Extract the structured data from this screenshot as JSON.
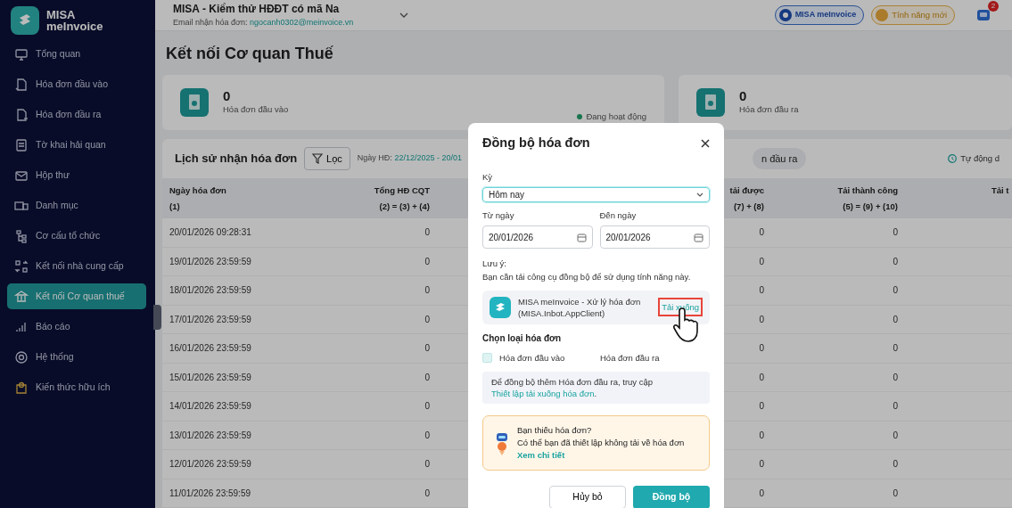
{
  "sidebar": {
    "logo": {
      "line1": "MISA",
      "line2": "meInvoice"
    },
    "items": [
      {
        "label": "Tổng quan",
        "selected": false
      },
      {
        "label": "Hóa đơn đầu vào",
        "selected": false
      },
      {
        "label": "Hóa đơn đầu ra",
        "selected": false
      },
      {
        "label": "Tờ khai hải quan",
        "selected": false
      },
      {
        "label": "Hộp thư",
        "selected": false
      },
      {
        "label": "Danh mục",
        "selected": false
      },
      {
        "label": "Cơ cấu tổ chức",
        "selected": false
      },
      {
        "label": "Kết nối nhà cung cấp",
        "selected": false
      },
      {
        "label": "Kết nối Cơ quan thuế",
        "selected": true
      },
      {
        "label": "Báo cáo",
        "selected": false
      },
      {
        "label": "Hệ thống",
        "selected": false
      },
      {
        "label": "Kiến thức hữu ích",
        "selected": false
      }
    ]
  },
  "header": {
    "company": "MISA - Kiểm thử HĐĐT có mã Na",
    "email_label": "Email nhận hóa đơn:",
    "email": "ngocanh0302@meinvoice.vn",
    "brand_badge": "MISA meInvoice",
    "new_features": "Tính năng mới",
    "notification_count": "2"
  },
  "page_title": "Kết nối Cơ quan Thuế",
  "stats": [
    {
      "value": "0",
      "label": "Hóa đơn đầu vào",
      "status": {
        "text": "Đang hoạt động",
        "active": true
      }
    },
    {
      "value": "0",
      "label": "Hóa đơn đầu ra"
    }
  ],
  "history": {
    "title": "Lịch sử nhận hóa đơn",
    "filter_button": "Lọc",
    "date_label": "Ngày HĐ:",
    "date_range": "22/12/2025 - 20/01",
    "tab": "n đầu ra",
    "auto_label": "Tự động d",
    "columns": [
      {
        "title": "Ngày hóa đơn",
        "formula": "(1)"
      },
      {
        "title": "Tổng HĐ CQT",
        "formula": "(2) = (3) + (4)"
      },
      {
        "title": "tải được",
        "formula": "(7) + (8)"
      },
      {
        "title": "Tải thành công",
        "formula": "(5) = (9) + (10)"
      },
      {
        "title": "Tải t"
      }
    ],
    "rows": [
      [
        "20/01/2026 09:28:31",
        "0",
        "0",
        "0"
      ],
      [
        "19/01/2026 23:59:59",
        "0",
        "0",
        "0"
      ],
      [
        "18/01/2026 23:59:59",
        "0",
        "0",
        "0"
      ],
      [
        "17/01/2026 23:59:59",
        "0",
        "0",
        "0"
      ],
      [
        "16/01/2026 23:59:59",
        "0",
        "0",
        "0"
      ],
      [
        "15/01/2026 23:59:59",
        "0",
        "0",
        "0"
      ],
      [
        "14/01/2026 23:59:59",
        "0",
        "0",
        "0"
      ],
      [
        "13/01/2026 23:59:59",
        "0",
        "0",
        "0"
      ],
      [
        "12/01/2026 23:59:59",
        "0",
        "0",
        "0"
      ],
      [
        "11/01/2026 23:59:59",
        "0",
        "0",
        "0"
      ]
    ]
  },
  "dialog": {
    "title": "Đồng bộ hóa đơn",
    "period": {
      "label": "Kỳ",
      "value": "Hôm nay",
      "focused": true
    },
    "from": {
      "label": "Từ ngày",
      "value": "20/01/2026"
    },
    "to": {
      "label": "Đến ngày",
      "value": "20/01/2026"
    },
    "note_title": "Lưu ý:",
    "note": "Bạn cần tải công cụ đồng bộ để sử dụng tính năng này.",
    "app": {
      "name": "MISA meInvoice - Xử lý hóa đơn",
      "package": "(MISA.Inbot.AppClient)",
      "link": "Tải xuống",
      "highlighted": true
    },
    "type_title": "Chọn loại hóa đơn",
    "types": [
      {
        "kind": "checkbox",
        "label": "Hóa đơn đầu vào",
        "checked": false
      },
      {
        "kind": "text",
        "label": "Hóa đơn đầu ra"
      }
    ],
    "info": {
      "text": "Để đồng bộ thêm Hóa đơn đầu ra, truy cập ",
      "link": "Thiết lập tải xuống hóa đơn",
      "end": "."
    },
    "warning": {
      "title": "Bạn thiếu hóa đơn?",
      "text": "Có thể bạn đã thiết lập không tải về hóa đơn",
      "link": "Xem chi tiết"
    },
    "buttons": [
      {
        "label": "Hủy bỏ",
        "kind": "secondary"
      },
      {
        "label": "Đồng bộ",
        "kind": "primary"
      }
    ]
  }
}
